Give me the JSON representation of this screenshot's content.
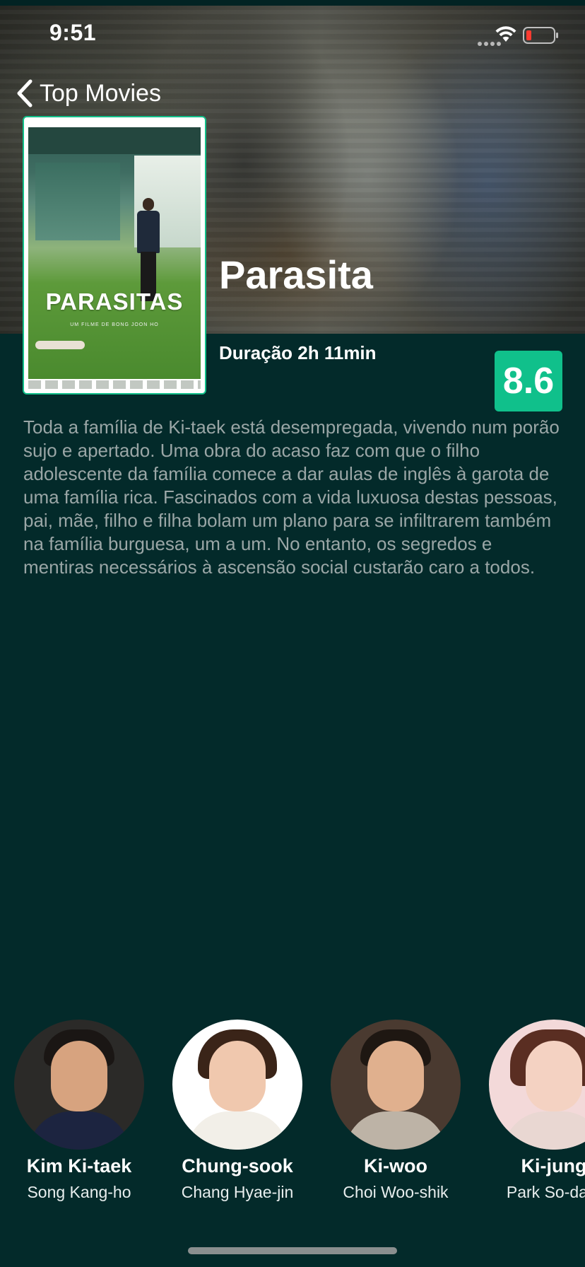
{
  "status_bar": {
    "time": "9:51"
  },
  "nav": {
    "back_label": "Top Movies"
  },
  "movie": {
    "title": "Parasita",
    "duration": "Duração 2h 11min",
    "rating": "8.6",
    "synopsis": "Toda a família de Ki-taek está desempregada, vivendo num porão sujo e apertado. Uma obra do acaso faz com que o filho adolescente da família comece a dar aulas de inglês à garota de uma família rica. Fascinados com a vida luxuosa destas pessoas, pai, mãe, filho e filha bolam um plano para se infiltrarem também na família burguesa, um a um. No entanto, os segredos e mentiras necessários à ascensão social custarão caro a todos."
  },
  "poster": {
    "title": "PARASITAS",
    "director_line": "UM FILME DE BONG JOON HO"
  },
  "cast": [
    {
      "character": "Kim Ki-taek",
      "actor": "Song Kang-ho"
    },
    {
      "character": "Chung-sook",
      "actor": "Chang Hyae-jin"
    },
    {
      "character": "Ki-woo",
      "actor": "Choi Woo-shik"
    },
    {
      "character": "Ki-jung",
      "actor": "Park So-dam"
    }
  ],
  "colors": {
    "background": "#032a2a",
    "accent": "#10c08b",
    "synopsis_text": "#9aa6a6"
  }
}
